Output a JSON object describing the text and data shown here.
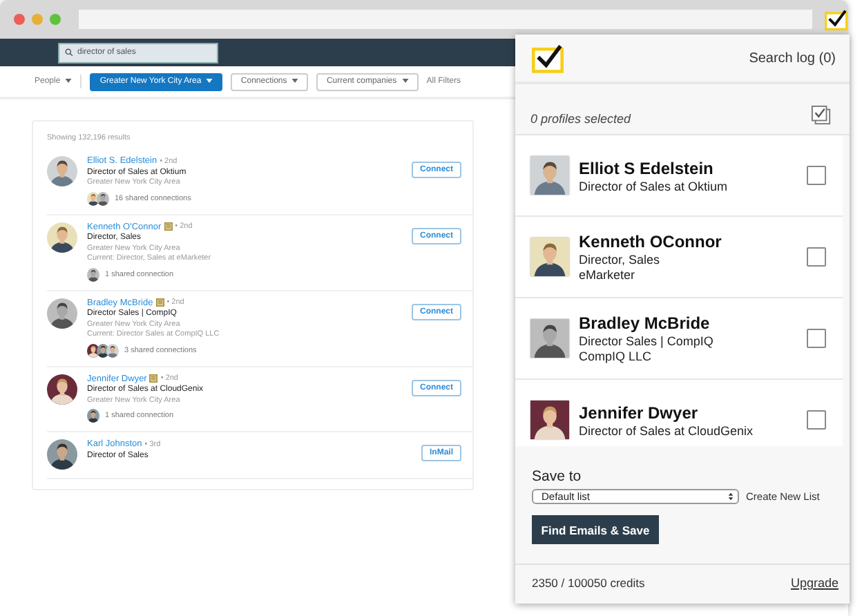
{
  "search": {
    "value": "director of sales"
  },
  "filters": [
    {
      "label": "People",
      "kind": "menu",
      "selected": false
    },
    {
      "label": "Greater New York City Area",
      "kind": "dropdown",
      "selected": true
    },
    {
      "label": "Connections",
      "kind": "dropdown",
      "selected": false
    },
    {
      "label": "Current companies",
      "kind": "dropdown",
      "selected": false
    },
    {
      "label": "All Filters",
      "kind": "link",
      "selected": false
    }
  ],
  "results_count": "Showing 132,196 results",
  "results": [
    {
      "name": "Elliot S. Edelstein",
      "premium": false,
      "degree": "• 2nd",
      "headline": "Director of Sales at Oktium",
      "location": "Greater New York City Area",
      "shared": "16 shared connections",
      "action": "Connect"
    },
    {
      "name": "Kenneth O'Connor",
      "premium": true,
      "degree": "• 2nd",
      "headline": "Director, Sales",
      "location": "Greater New York City Area",
      "current": "Current: Director, Sales at eMarketer",
      "shared": "1 shared connection",
      "action": "Connect"
    },
    {
      "name": "Bradley McBride",
      "premium": true,
      "degree": "• 2nd",
      "headline": "Director Sales | CompIQ",
      "location": "Greater New York City Area",
      "current": "Current: Director Sales at CompIQ LLC",
      "shared": "3 shared connections",
      "action": "Connect"
    },
    {
      "name": "Jennifer Dwyer",
      "premium": true,
      "degree": "• 2nd",
      "headline": "Director of Sales at CloudGenix",
      "location": "Greater New York City Area",
      "shared": "1 shared connection",
      "action": "Connect"
    },
    {
      "name": "Karl Johnston",
      "premium": false,
      "degree": "• 3rd",
      "headline": "Director of Sales",
      "action": "InMail"
    }
  ],
  "extension": {
    "search_log": "Search log (0)",
    "selected_count": "0 profiles selected",
    "profiles": [
      {
        "name": "Elliot S Edelstein",
        "lines": [
          "Director of Sales at Oktium"
        ],
        "checked": false
      },
      {
        "name": "Kenneth OConnor",
        "lines": [
          "Director, Sales",
          "eMarketer"
        ],
        "checked": false
      },
      {
        "name": "Bradley McBride",
        "lines": [
          "Director Sales | CompIQ",
          "CompIQ LLC"
        ],
        "checked": false
      },
      {
        "name": "Jennifer Dwyer",
        "lines": [
          "Director of Sales at CloudGenix"
        ],
        "checked": false
      }
    ],
    "save_label": "Save to",
    "list_select": "Default list",
    "create_link": "Create New List",
    "save_button": "Find Emails & Save",
    "credits": "2350 / 100050 credits",
    "upgrade_link": "Upgrade"
  }
}
